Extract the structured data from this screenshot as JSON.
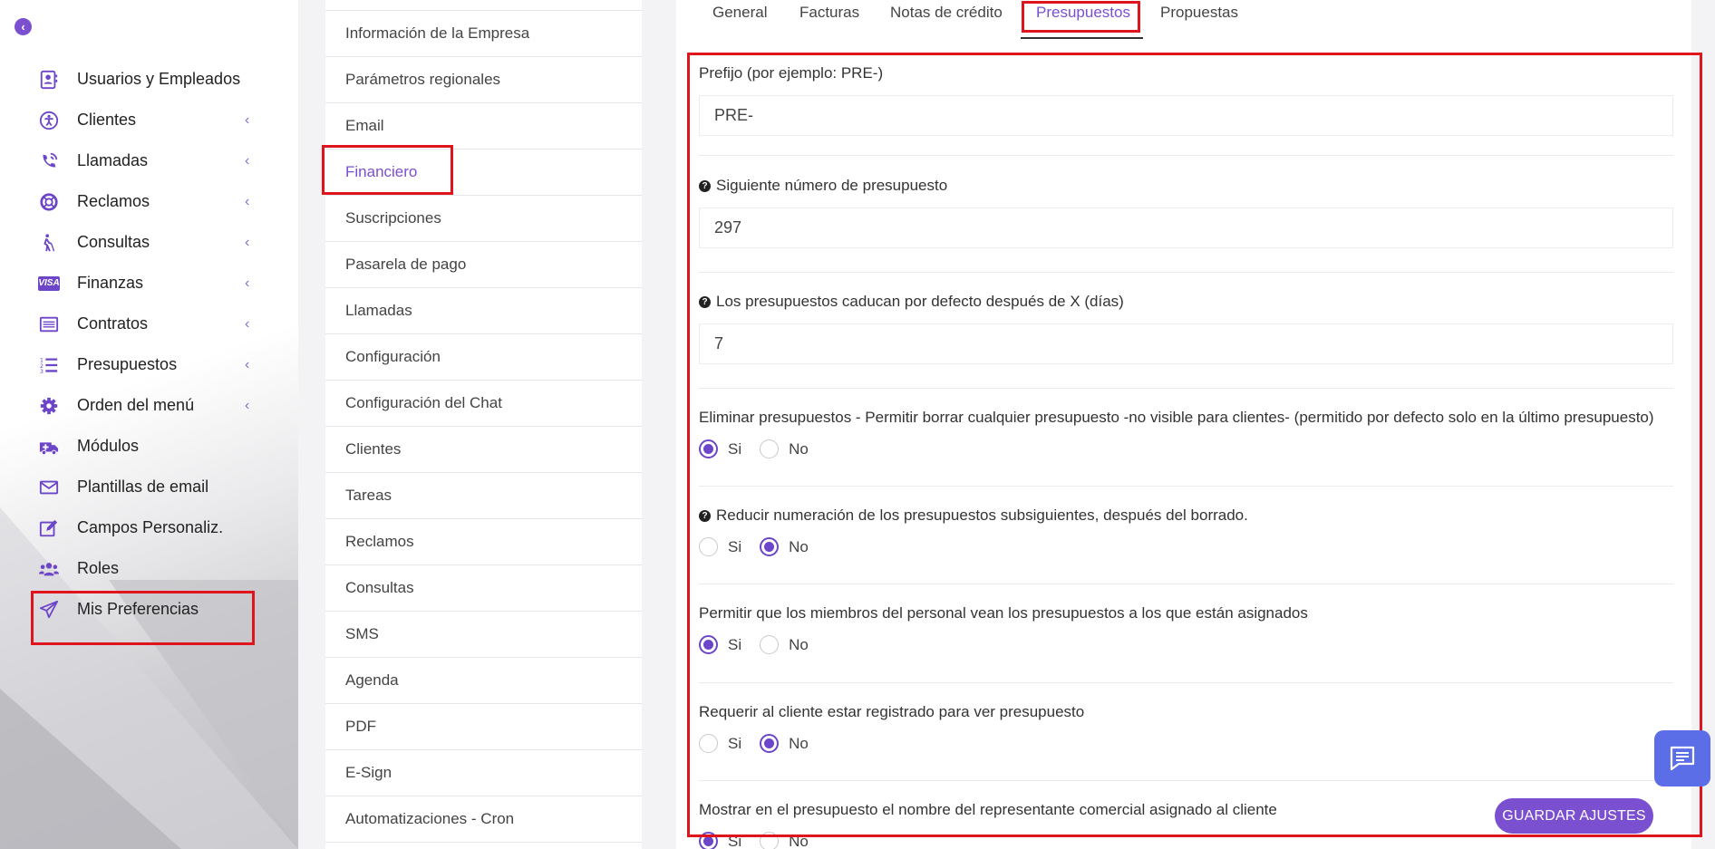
{
  "sidebar": {
    "back_icon": "chevron-left-circle-icon",
    "items": [
      {
        "label": "Usuarios y Empleados",
        "icon": "user-card-icon",
        "has_chevron": false
      },
      {
        "label": "Clientes",
        "icon": "accessibility-icon",
        "has_chevron": true
      },
      {
        "label": "Llamadas",
        "icon": "phone-call-icon",
        "has_chevron": true
      },
      {
        "label": "Reclamos",
        "icon": "lifebuoy-icon",
        "has_chevron": true
      },
      {
        "label": "Consultas",
        "icon": "walking-person-icon",
        "has_chevron": true
      },
      {
        "label": "Finanzas",
        "icon": "visa-card-icon",
        "has_chevron": true
      },
      {
        "label": "Contratos",
        "icon": "list-box-icon",
        "has_chevron": true
      },
      {
        "label": "Presupuestos",
        "icon": "numbered-list-icon",
        "has_chevron": true
      },
      {
        "label": "Orden del menú",
        "icon": "gear-icon",
        "has_chevron": true
      },
      {
        "label": "Módulos",
        "icon": "ambulance-icon",
        "has_chevron": false
      },
      {
        "label": "Plantillas de email",
        "icon": "envelope-icon",
        "has_chevron": false
      },
      {
        "label": "Campos Personaliz.",
        "icon": "edit-icon",
        "has_chevron": false
      },
      {
        "label": "Roles",
        "icon": "users-icon",
        "has_chevron": false
      },
      {
        "label": "Mis Preferencias",
        "icon": "paper-plane-icon",
        "has_chevron": false
      }
    ],
    "chevron": "‹"
  },
  "submenu": {
    "items": [
      "",
      "Información de la Empresa",
      "Parámetros regionales",
      "Email",
      "Financiero",
      "Suscripciones",
      "Pasarela de pago",
      "Llamadas",
      "Configuración",
      "Configuración del Chat",
      "Clientes",
      "Tareas",
      "Reclamos",
      "Consultas",
      "SMS",
      "Agenda",
      "PDF",
      "E-Sign",
      "Automatizaciones - Cron"
    ],
    "active": "Financiero"
  },
  "tabs": {
    "items": [
      "General",
      "Facturas",
      "Notas de crédito",
      "Presupuestos",
      "Propuestas"
    ],
    "active": "Presupuestos"
  },
  "form": {
    "prefix": {
      "label": "Prefijo (por ejemplo: PRE-)",
      "value": "PRE-"
    },
    "next_number": {
      "label": "Siguiente número de presupuesto",
      "value": "297"
    },
    "expiry_days": {
      "label": "Los presupuestos caducan por defecto después de X (días)",
      "value": "7"
    },
    "delete_estimates": {
      "label": "Eliminar presupuestos - Permitir borrar cualquier presupuesto -no visible para clientes- (permitido por defecto solo en la último presupuesto)",
      "selected": "Si"
    },
    "reduce_numbering": {
      "label": "Reducir numeración de los presupuestos subsiguientes, después del borrado.",
      "selected": "No"
    },
    "staff_assigned": {
      "label": "Permitir que los miembros del personal vean los presupuestos a los que están asignados",
      "selected": "Si"
    },
    "require_login": {
      "label": "Requerir al cliente estar registrado para ver presupuesto",
      "selected": "No"
    },
    "show_sales_agent": {
      "label": "Mostrar en el presupuesto el nombre del representante comercial asignado al cliente",
      "selected": "Si"
    },
    "yes_label": "Si",
    "no_label": "No",
    "help_glyph": "?"
  },
  "actions": {
    "save_label": "GUARDAR AJUSTES",
    "chat_icon": "chat-icon"
  },
  "colors": {
    "accent": "#7a4fd0",
    "highlight": "#e0141c",
    "chat": "#5b6ee8"
  }
}
